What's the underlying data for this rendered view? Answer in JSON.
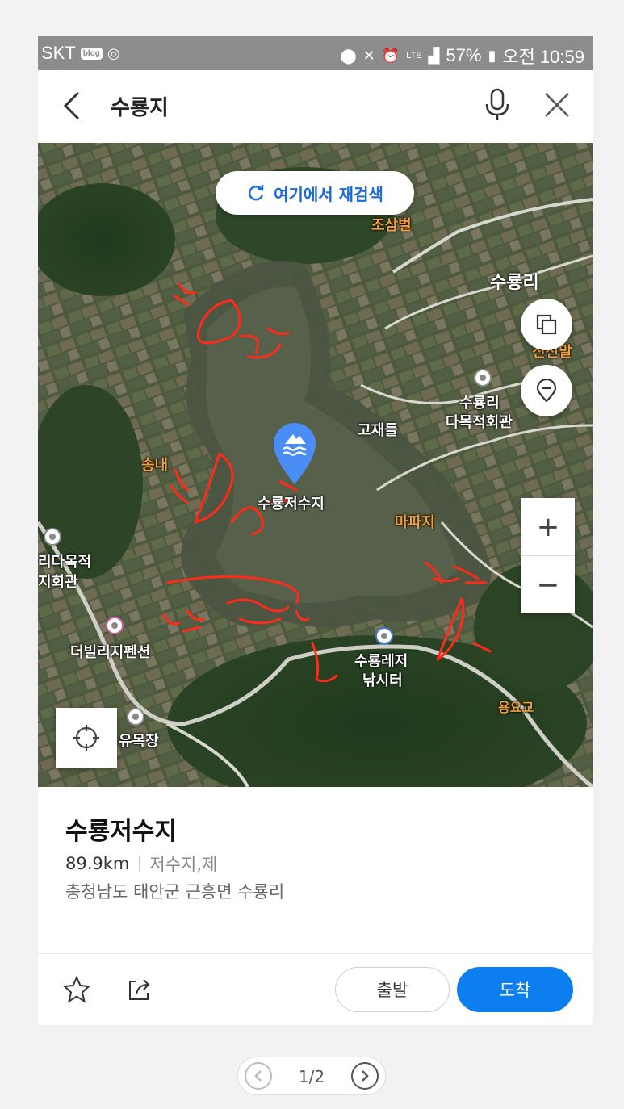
{
  "status_bar": {
    "carrier": "SKT",
    "blog_badge": "blog",
    "network": "LTE",
    "battery": "57%",
    "time": "오전 10:59"
  },
  "search": {
    "title": "수룡지"
  },
  "map": {
    "research_label": "여기에서 재검색",
    "labels": {
      "josambeol": "조삼벌",
      "suryongri": "수룡리",
      "sinjeonmal": "신전말",
      "community_hall_1": "수룡리",
      "community_hall_2": "다목적회관",
      "gojaedeul": "고재들",
      "songnae": "송내",
      "reservoir": "수룡저수지",
      "mapaji": "마파지",
      "left_hall_1": "리다목적",
      "left_hall_2": "지회관",
      "pension": "더빌리지펜션",
      "leisure_1": "수룡레저",
      "leisure_2": "낚시터",
      "yongyogyo": "용요교",
      "ranch": "유목장"
    }
  },
  "place": {
    "name": "수룡저수지",
    "distance": "89.9km",
    "category": "저수지,제",
    "address": "충청남도 태안군 근흥면 수룡리"
  },
  "actions": {
    "depart": "출발",
    "arrive": "도착"
  },
  "pager": {
    "count": "1/2"
  },
  "colors": {
    "accent": "#0d7ef0",
    "status_bar": "#8c8c8c",
    "annotation": "#ff2a1a"
  }
}
